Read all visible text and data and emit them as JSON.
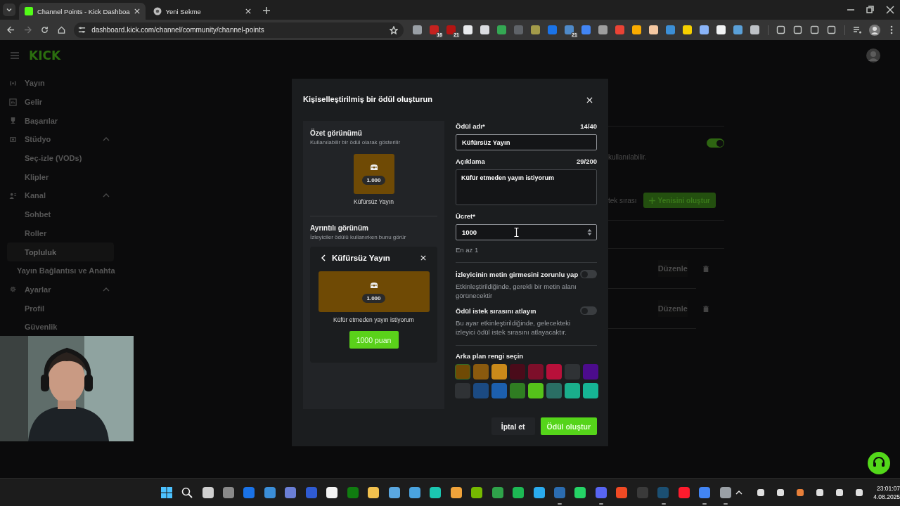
{
  "browser": {
    "tabs": [
      {
        "title": "Channel Points - Kick Dashboa",
        "selected": true,
        "kind": "site"
      },
      {
        "title": "Yeni Sekme",
        "selected": false,
        "kind": "chrome"
      }
    ],
    "url": "dashboard.kick.com/channel/community/channel-points",
    "extensions": [
      {
        "color": "#9aa0a6"
      },
      {
        "color": "#c5221f",
        "badge": "16"
      },
      {
        "color": "#b31412",
        "badge": "21"
      },
      {
        "color": "#e8eaed"
      },
      {
        "color": "#dadce0"
      },
      {
        "color": "#34a853"
      },
      {
        "color": "#5f6368"
      },
      {
        "color": "#a39b4a"
      },
      {
        "color": "#1a73e8"
      },
      {
        "color": "#4f8ac9",
        "badge": "21"
      },
      {
        "color": "#4285f4"
      },
      {
        "color": "#9e9e9e"
      },
      {
        "color": "#ea4335"
      },
      {
        "color": "#f9ab00"
      },
      {
        "color": "#f4c7a1"
      },
      {
        "color": "#3c8fd6"
      },
      {
        "color": "#f6d000"
      },
      {
        "color": "#8ab4f8"
      },
      {
        "color": "#f1f3f4"
      },
      {
        "color": "#5aa0d8"
      },
      {
        "color": "#bdc1c6"
      }
    ],
    "tools": [
      {
        "color": "#c4c7c5"
      },
      {
        "color": "#c4c7c5"
      },
      {
        "color": "#c4c7c5"
      },
      {
        "color": "#c4c7c5"
      }
    ]
  },
  "header": {
    "logo": "KICK"
  },
  "sidebar": {
    "items": [
      {
        "label": "Yayın",
        "kind": "broadcast",
        "selected": false
      },
      {
        "label": "Gelir",
        "kind": "revenue",
        "selected": false
      },
      {
        "label": "Başarılar",
        "kind": "trophy",
        "selected": false
      },
      {
        "label": "Stüdyo",
        "kind": "studio",
        "selected": false,
        "expanded": true,
        "children": [
          {
            "label": "Seç-izle (VODs)",
            "selected": false
          },
          {
            "label": "Klipler",
            "selected": false
          }
        ]
      },
      {
        "label": "Kanal",
        "kind": "channel",
        "selected": false,
        "expanded": true,
        "children": [
          {
            "label": "Sohbet",
            "selected": false
          },
          {
            "label": "Roller",
            "selected": false
          },
          {
            "label": "Topluluk",
            "selected": true
          }
        ]
      },
      {
        "label": "Yayın Bağlantısı ve Anahta",
        "selected": false
      },
      {
        "label": "Ayarlar",
        "kind": "settings",
        "selected": false,
        "expanded": true,
        "children": [
          {
            "label": "Profil",
            "selected": false
          },
          {
            "label": "Güvenlik",
            "selected": false
          }
        ]
      }
    ]
  },
  "background": {
    "toggle_on": true,
    "notice": "kullanılabilir.",
    "queue_label": "tek sırası",
    "create_button": "Yenisini oluştur",
    "rows": [
      {
        "action": "Düzenle"
      },
      {
        "action": "Düzenle"
      }
    ]
  },
  "modal": {
    "title": "Kişiselleştirilmiş bir ödül oluşturun",
    "summary": {
      "title": "Özet görünümü",
      "hint": "Kullanılabilir bir ödül olarak gösterilir",
      "cost": "1.000",
      "name": "Küfürsüz Yayın"
    },
    "detail": {
      "title": "Ayrıntılı görünüm",
      "hint": "İzleyiciler ödülü kullanırken bunu görür",
      "card_title": "Küfürsüz Yayın",
      "cost": "1.000",
      "description": "Küfür etmeden yayın istiyorum",
      "button": "1000 puan"
    },
    "fields": [
      {
        "kind": "text",
        "label": "Ödül adı*",
        "counter": "14/40",
        "value": "Küfürsüz Yayın"
      },
      {
        "kind": "textarea",
        "label": "Açıklama",
        "counter": "29/200",
        "value": "Küfür etmeden yayın istiyorum"
      },
      {
        "kind": "number",
        "label": "Ücret*",
        "value": "1000",
        "hint": "En az 1"
      }
    ],
    "toggles": [
      {
        "label": "İzleyicinin metin girmesini zorunlu yap",
        "description": "Etkinleştirildiğinde, gerekli bir metin alanı görünecektir",
        "on": false
      },
      {
        "label": "Ödül istek sırasını atlayın",
        "description": "Bu ayar etkinleştirildiğinde, gelecekteki izleyici ödül istek sırasını atlayacaktır.",
        "on": false
      }
    ],
    "color_label": "Arka plan rengi seçin",
    "colors": [
      {
        "color": "#6f4a05",
        "selected": true
      },
      {
        "color": "#8a5a0e",
        "selected": false
      },
      {
        "color": "#c98a1a",
        "selected": false
      },
      {
        "color": "#4a0b1a",
        "selected": false
      },
      {
        "color": "#7d0f2a",
        "selected": false
      },
      {
        "color": "#b8103a",
        "selected": false
      },
      {
        "color": "#2f3235",
        "selected": false
      },
      {
        "color": "#4c0c8c",
        "selected": false
      },
      {
        "color": "#2f3235",
        "selected": false
      },
      {
        "color": "#1b4a82",
        "selected": false
      },
      {
        "color": "#1c5fae",
        "selected": false
      },
      {
        "color": "#2f7d22",
        "selected": false
      },
      {
        "color": "#55c21a",
        "selected": false
      },
      {
        "color": "#2a6e64",
        "selected": false
      },
      {
        "color": "#1aae8c",
        "selected": false
      },
      {
        "color": "#16b494",
        "selected": false
      }
    ],
    "buttons": [
      {
        "kind": "secondary",
        "label": "İptal et"
      },
      {
        "kind": "primary",
        "label": "Ödül oluştur"
      }
    ]
  },
  "taskbar": {
    "apps": [
      {
        "kind": "windows"
      },
      {
        "kind": "search"
      },
      {
        "kind": "app",
        "color": "#cfcfcf",
        "running": false
      },
      {
        "kind": "app",
        "color": "#8a8a8a",
        "running": false
      },
      {
        "kind": "app",
        "color": "#1a73e8",
        "running": false
      },
      {
        "kind": "app",
        "color": "#3b8ed8",
        "running": false
      },
      {
        "kind": "app",
        "color": "#6b7fd6",
        "running": false
      },
      {
        "kind": "app",
        "color": "#2f5bd3",
        "running": false
      },
      {
        "kind": "app",
        "color": "#f3f3f3",
        "running": false
      },
      {
        "kind": "app",
        "color": "#107c10",
        "running": false
      },
      {
        "kind": "app",
        "color": "#f2c14e",
        "running": false
      },
      {
        "kind": "app",
        "color": "#5aa7e0",
        "running": false
      },
      {
        "kind": "app",
        "color": "#4aa3df",
        "running": false
      },
      {
        "kind": "app",
        "color": "#1bc7b1",
        "running": false
      },
      {
        "kind": "app",
        "color": "#f0a33a",
        "running": false
      },
      {
        "kind": "app",
        "color": "#76b900",
        "running": false
      },
      {
        "kind": "app",
        "color": "#2fa34a",
        "running": false
      },
      {
        "kind": "app",
        "color": "#1db954",
        "running": false
      },
      {
        "kind": "app",
        "color": "#2aabee",
        "running": false
      },
      {
        "kind": "app",
        "color": "#2b6cb0",
        "running": true
      },
      {
        "kind": "app",
        "color": "#25d366",
        "running": false
      },
      {
        "kind": "app",
        "color": "#5865f2",
        "running": true
      },
      {
        "kind": "app",
        "color": "#f04a24",
        "running": false
      },
      {
        "kind": "app",
        "color": "#3a3a3a",
        "running": false
      },
      {
        "kind": "app",
        "color": "#1b4f72",
        "running": true
      },
      {
        "kind": "app",
        "color": "#ff1b2d",
        "running": false
      },
      {
        "kind": "app",
        "color": "#4285f4",
        "running": true
      },
      {
        "kind": "app",
        "color": "#9aa0a6",
        "running": true
      }
    ],
    "tray": [
      {
        "color": "#e0e0e0"
      },
      {
        "color": "#e0e0e0"
      },
      {
        "color": "#e8803a"
      },
      {
        "color": "#e0e0e0"
      },
      {
        "color": "#e0e0e0"
      },
      {
        "color": "#e0e0e0"
      }
    ],
    "time": "23:01:07",
    "date": "4.08.2025"
  }
}
